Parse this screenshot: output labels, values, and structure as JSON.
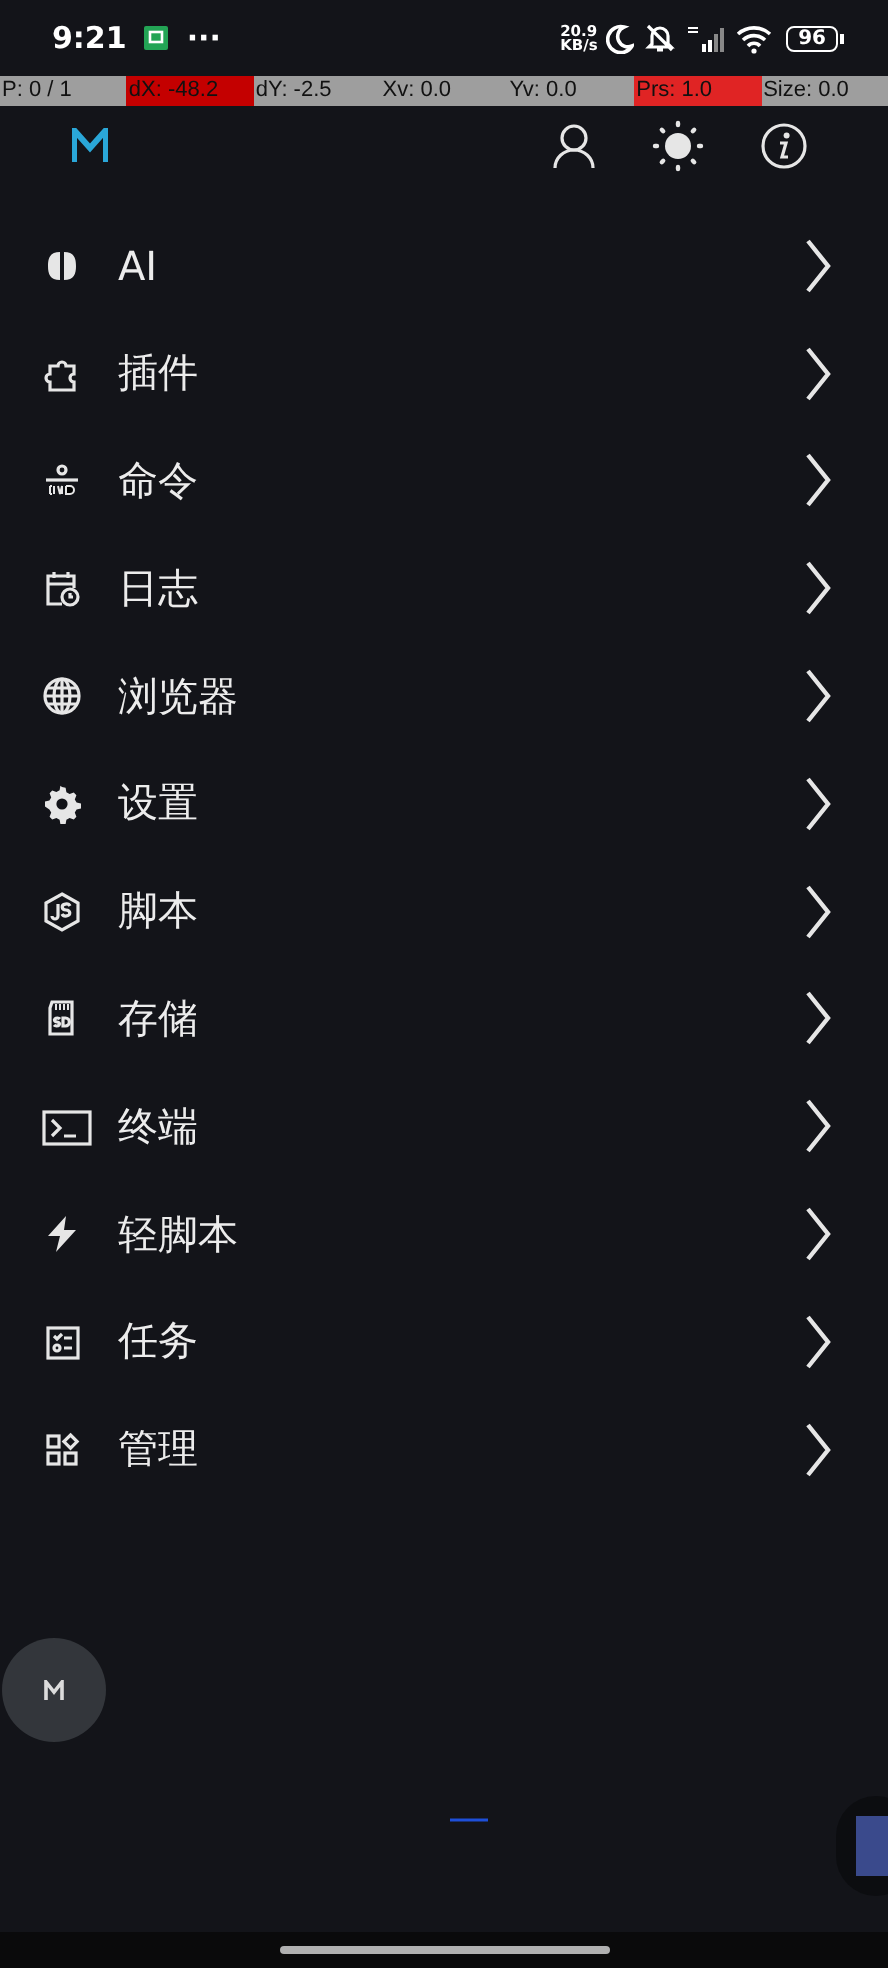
{
  "status_bar": {
    "time": "9:21",
    "more": "···",
    "net_speed": "20.9 KB/s",
    "battery": "96"
  },
  "pointer_bar": [
    {
      "text": "P: 0 / 1",
      "color": "#9e9e9e"
    },
    {
      "text": "dX: -48.2",
      "color": "#c40000"
    },
    {
      "text": "dY: -2.5",
      "color": "#9e9e9e"
    },
    {
      "text": "Xv: 0.0",
      "color": "#9e9e9e"
    },
    {
      "text": "Yv: 0.0",
      "color": "#9e9e9e"
    },
    {
      "text": "Prs: 1.0",
      "color": "#e02424"
    },
    {
      "text": "Size: 0.0",
      "color": "#9e9e9e"
    }
  ],
  "menu": [
    {
      "label": "AI"
    },
    {
      "label": "插件"
    },
    {
      "label": "命令"
    },
    {
      "label": "日志"
    },
    {
      "label": "浏览器"
    },
    {
      "label": "设置"
    },
    {
      "label": "脚本"
    },
    {
      "label": "存储"
    },
    {
      "label": "终端"
    },
    {
      "label": "轻脚本"
    },
    {
      "label": "任务"
    },
    {
      "label": "管理"
    }
  ]
}
